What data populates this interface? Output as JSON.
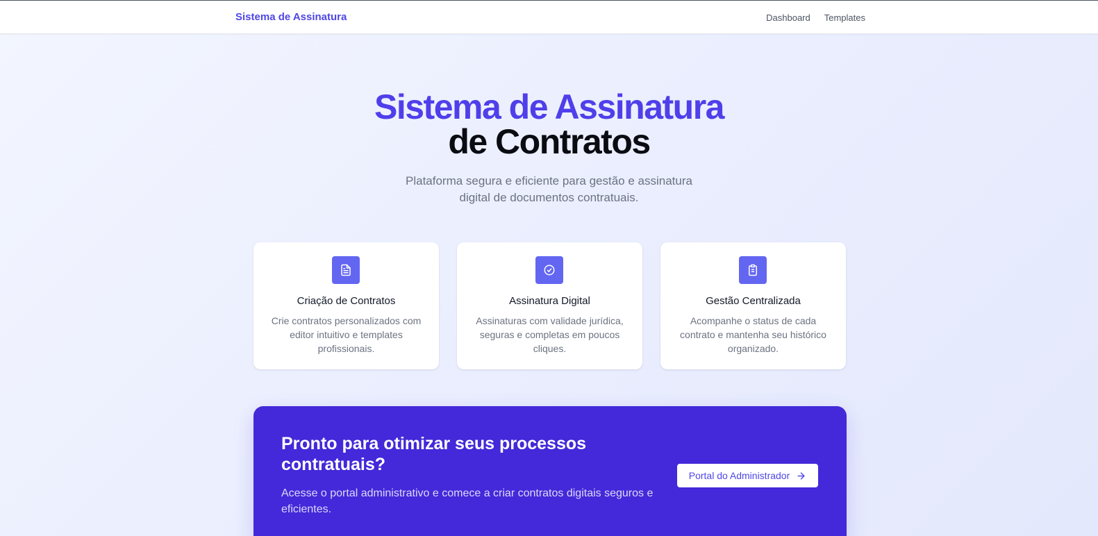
{
  "header": {
    "brand": "Sistema de Assinatura",
    "nav": [
      {
        "label": "Dashboard"
      },
      {
        "label": "Templates"
      }
    ]
  },
  "hero": {
    "title_line1": "Sistema de Assinatura",
    "title_line2": "de Contratos",
    "subtitle": "Plataforma segura e eficiente para gestão e assinatura digital de documentos contratuais."
  },
  "features": [
    {
      "icon": "document-icon",
      "title": "Criação de Contratos",
      "description": "Crie contratos personalizados com editor intuitivo e templates profissionais."
    },
    {
      "icon": "check-circle-icon",
      "title": "Assinatura Digital",
      "description": "Assinaturas com validade jurídica, seguras e completas em poucos cliques."
    },
    {
      "icon": "clipboard-icon",
      "title": "Gestão Centralizada",
      "description": "Acompanhe o status de cada contrato e mantenha seu histórico organizado."
    }
  ],
  "cta": {
    "title": "Pronto para otimizar seus processos contratuais?",
    "description": "Acesse o portal administrativo e comece a criar contratos digitais seguros e eficientes.",
    "button_label": "Portal do Administrador",
    "button_icon": "arrow-right-icon"
  },
  "colors": {
    "accent": "#4f46e5",
    "icon_bg": "#6366f1",
    "cta_bg": "#4329d9",
    "page_bg": "#eef1fd"
  }
}
